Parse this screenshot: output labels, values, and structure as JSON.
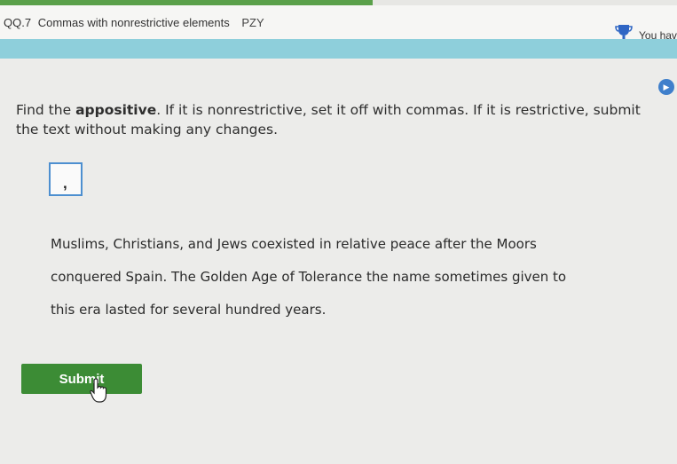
{
  "header": {
    "skill_code": "QQ.7",
    "skill_name": "Commas with nonrestrictive elements",
    "skill_tag": "PZY",
    "you_have": "You have"
  },
  "progress": {
    "fraction": 0.55
  },
  "question": {
    "instruction_before": "Find the ",
    "instruction_bold": "appositive",
    "instruction_after": ". If it is nonrestrictive, set it off with commas. If it is restrictive, submit the text without making any changes.",
    "comma_glyph": ",",
    "passage_lines": [
      "Muslims, Christians, and Jews coexisted in relative peace after the Moors",
      "conquered Spain. The Golden Age of Tolerance the name sometimes given to",
      "this era lasted for several hundred years."
    ]
  },
  "actions": {
    "submit_label": "Submit"
  },
  "colors": {
    "accent": "#3c8c35",
    "band": "#8ecfdb",
    "tool_border": "#4d8fd0",
    "speaker": "#3f7fcb"
  },
  "icons": {
    "trophy": "trophy-icon",
    "speaker": "speaker-icon",
    "cursor": "hand-cursor-icon"
  }
}
